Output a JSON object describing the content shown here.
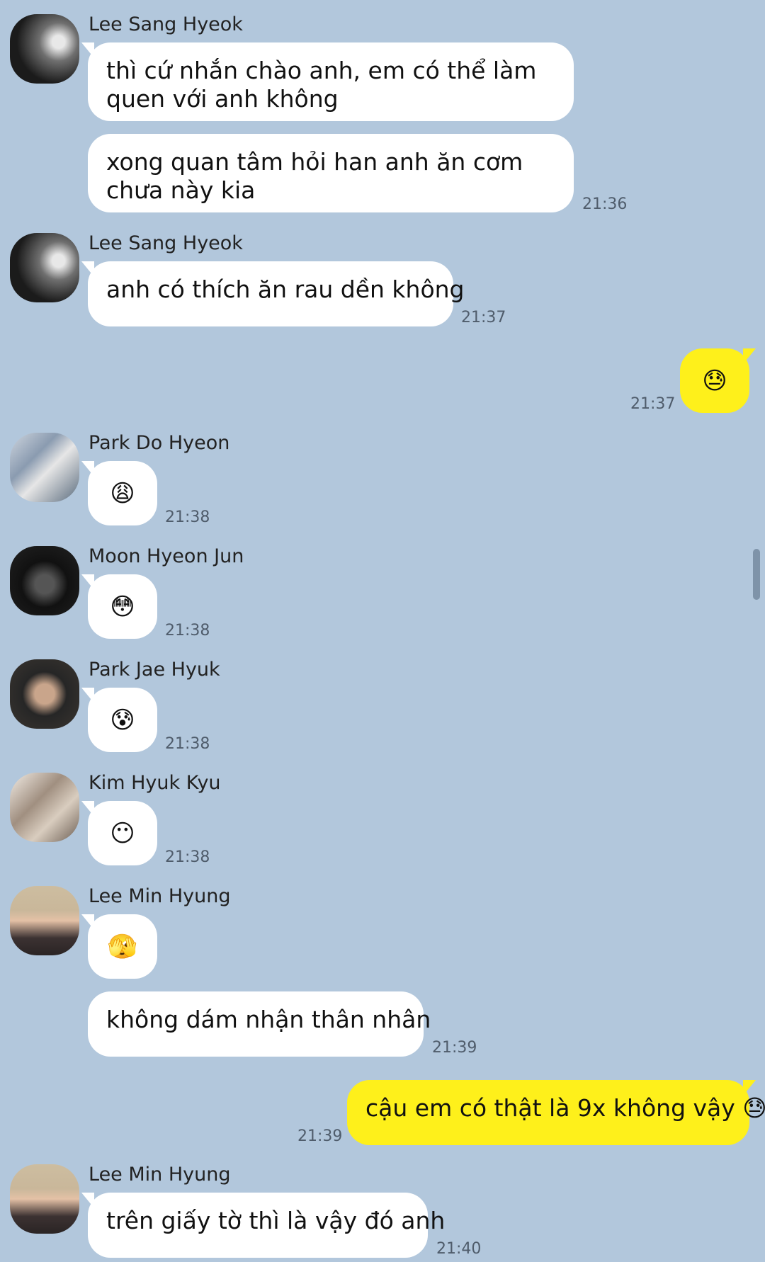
{
  "messages": [
    {
      "sender": "Lee Sang Hyeok",
      "text": "thì cứ nhắn chào anh, em có thể làm quen với anh không"
    },
    {
      "sender": "Lee Sang Hyeok",
      "text": "xong quan tâm hỏi han anh ăn cơm chưa này kia",
      "time": "21:36"
    },
    {
      "sender": "Lee Sang Hyeok",
      "text": "anh có thích ăn rau dền không",
      "time": "21:37"
    },
    {
      "sender": "me",
      "text": "😓",
      "time": "21:37"
    },
    {
      "sender": "Park Do Hyeon",
      "text": "😩",
      "time": "21:38"
    },
    {
      "sender": "Moon Hyeon Jun",
      "text": "😳",
      "time": "21:38"
    },
    {
      "sender": "Park Jae Hyuk",
      "text": "😰",
      "time": "21:38"
    },
    {
      "sender": "Kim Hyuk Kyu",
      "text": "😶",
      "time": "21:38"
    },
    {
      "sender": "Lee Min Hyung",
      "text": "🫣"
    },
    {
      "sender": "Lee Min Hyung",
      "text": "không dám nhận thân nhân",
      "time": "21:39"
    },
    {
      "sender": "me",
      "text": "cậu em có thật là 9x không vậy 😓",
      "time": "21:39"
    },
    {
      "sender": "Lee Min Hyung",
      "text": "trên giấy tờ thì là vậy đó anh",
      "time": "21:40"
    }
  ],
  "colors": {
    "background": "#b2c7dc",
    "incoming_bubble": "#ffffff",
    "outgoing_bubble": "#fef01b",
    "timestamp": "#4f5c6b"
  }
}
